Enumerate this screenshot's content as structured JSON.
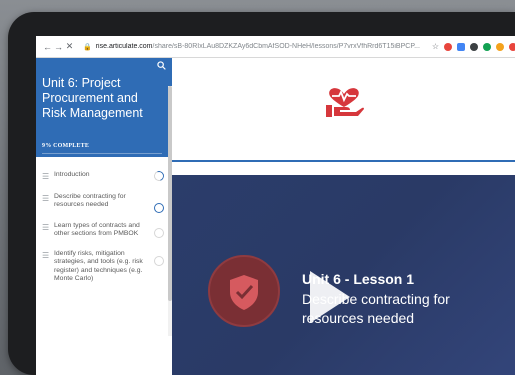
{
  "browser": {
    "back_icon": "arrow-left-icon",
    "forward_icon": "arrow-right-icon",
    "reload_icon": "close-icon",
    "url_domain": "rise.articulate.com",
    "url_path": "/share/sB-80RIxLAu8DZKZAy6dCbmAfSOD-NHeH/lessons/P7vrxVfhRrd6T15iBPCP...",
    "extension_colors": [
      "#e8453c",
      "#4285f4",
      "#3c4043",
      "#12a152",
      "#f4a21c",
      "#e8453c"
    ]
  },
  "sidebar": {
    "course_title": "Unit 6: Project Procurement and Risk Management",
    "progress_label": "9% COMPLETE",
    "lessons": [
      {
        "label": "Introduction",
        "status": "partial"
      },
      {
        "label": "Describe contracting for resources needed",
        "status": "active"
      },
      {
        "label": "Learn types of contracts and other sections from PMBOK",
        "status": "not-started"
      },
      {
        "label": "Identify risks, mitigation strategies, and tools (e.g. risk register) and techniques (e.g. Monte Carlo)",
        "status": "not-started"
      }
    ]
  },
  "main": {
    "hero_icon": "heart-in-hand-icon",
    "accent_color": "#2f6cb5",
    "video": {
      "heading": "Unit 6 - Lesson 1",
      "subtitle": "Describe contracting for resources needed",
      "badge_icon": "shield-check-icon",
      "play_icon": "play-icon"
    }
  }
}
